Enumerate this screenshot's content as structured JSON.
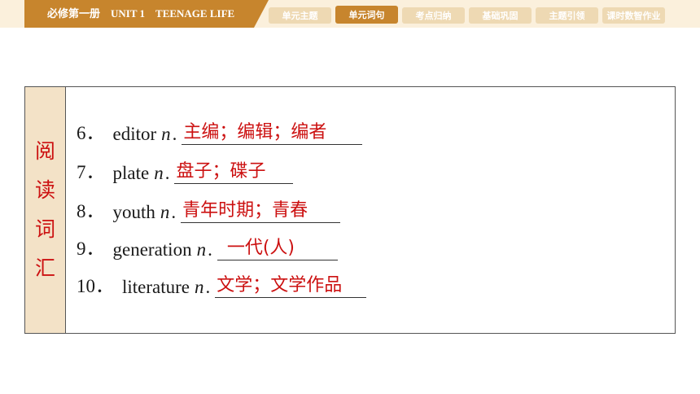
{
  "header": {
    "title": "必修第一册　UNIT 1　TEENAGE LIFE",
    "tabs": [
      {
        "label": "单元主题",
        "active": false
      },
      {
        "label": "单元词句",
        "active": true
      },
      {
        "label": "考点归纳",
        "active": false
      },
      {
        "label": "基础巩固",
        "active": false
      },
      {
        "label": "主题引领",
        "active": false
      },
      {
        "label": "课时数智作业",
        "active": false
      }
    ]
  },
  "colors": {
    "accent": "#c7852d",
    "answer": "#cc1111",
    "side_bg": "#f3e2c7",
    "band_bg": "#fbf0dc"
  },
  "side_label": [
    "阅",
    "读",
    "词",
    "汇"
  ],
  "vocab": [
    {
      "num": "6．",
      "word": "editor",
      "pos": "n",
      "answer": "主编；编辑；编者"
    },
    {
      "num": "7．",
      "word": "plate",
      "pos": "n",
      "answer": "盘子；碟子"
    },
    {
      "num": "8．",
      "word": "youth",
      "pos": "n",
      "answer": "青年时期；青春"
    },
    {
      "num": "9．",
      "word": "generation",
      "pos": "n",
      "answer": "一代(人)"
    },
    {
      "num": "10．",
      "word": "literature",
      "pos": "n",
      "answer": "文学；文学作品"
    }
  ]
}
